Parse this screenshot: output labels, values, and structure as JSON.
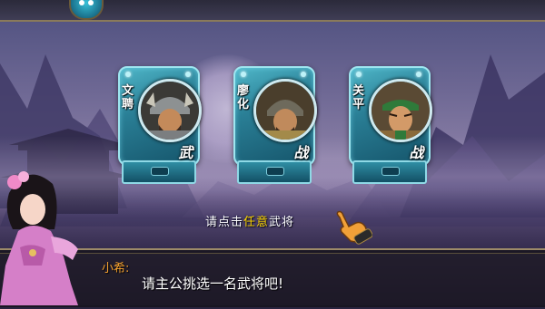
{
  "generals": [
    {
      "name": "文聘",
      "type": "武"
    },
    {
      "name": "廖化",
      "type": "战"
    },
    {
      "name": "关平",
      "type": "战"
    }
  ],
  "prompt": {
    "prefix": "请点击",
    "highlight": "任意",
    "suffix": "武将"
  },
  "dialog": {
    "speaker": "小希:",
    "text": "请主公挑选一名武将吧!"
  },
  "colors": {
    "card": "#2a7f96",
    "card_border": "#9ee6f0",
    "prompt_highlight": "#ffd800",
    "speaker": "#f3a030"
  },
  "icons": {
    "pet": "pet-avatar-icon",
    "pointer": "pointing-hand-icon"
  }
}
